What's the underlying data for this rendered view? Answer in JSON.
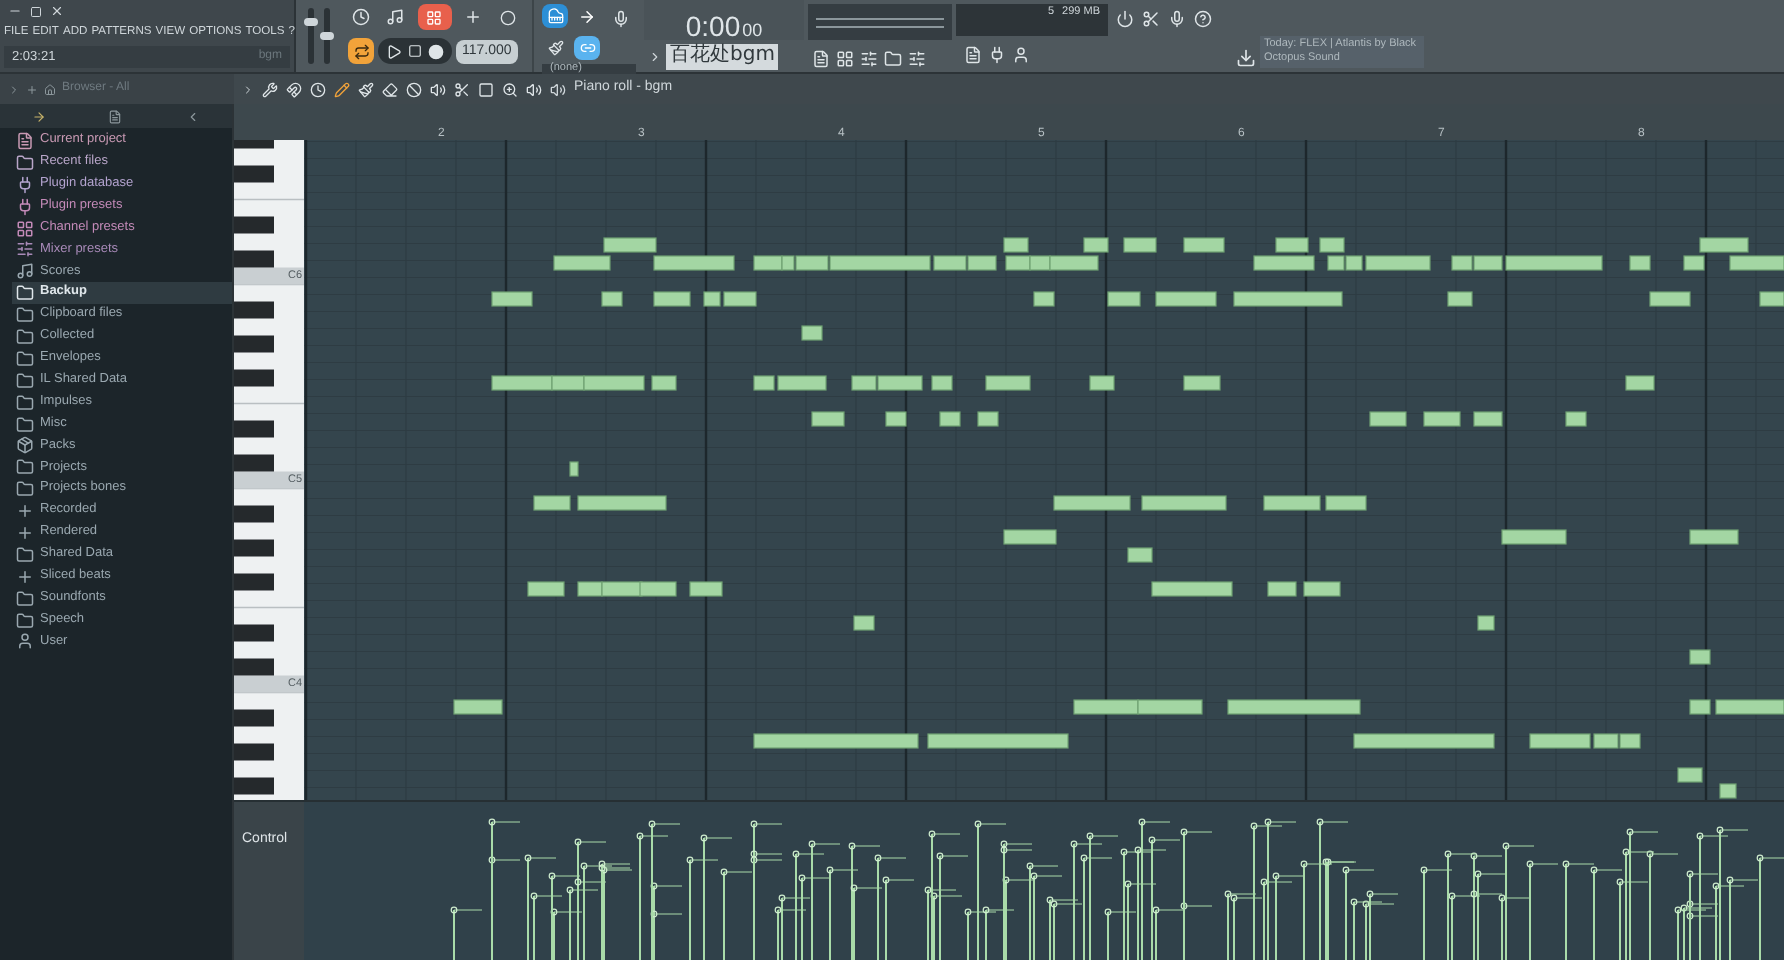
{
  "main_menu": {
    "items": [
      "FILE",
      "EDIT",
      "ADD",
      "PATTERNS",
      "VIEW",
      "OPTIONS",
      "TOOLS",
      "?"
    ],
    "song_time": "2:03:21",
    "hint": "bgm"
  },
  "master": {
    "volume": {
      "level": 0.8
    },
    "pitch": {
      "level": 0.5
    }
  },
  "transport": {
    "tempo": "117.000",
    "loop_mode_on": true
  },
  "snap": {
    "value": "(none)"
  },
  "time_display": {
    "main": "0:00",
    "sub": "00"
  },
  "pattern": {
    "name": "百花处bgm"
  },
  "cpu": {
    "polyphony": "5",
    "memory": "299 MB"
  },
  "news": {
    "label": "Today:",
    "text": "FLEX | Atlantis by Black Octopus Sound"
  },
  "browser": {
    "title": "Browser - All",
    "items": [
      {
        "label": "Current project",
        "kind": "project",
        "color": "#c99ab4",
        "selected": false
      },
      {
        "label": "Recent files",
        "kind": "recent",
        "color": "#b9a6c9",
        "selected": false
      },
      {
        "label": "Plugin database",
        "kind": "plugin",
        "color": "#b3a3cf",
        "selected": false
      },
      {
        "label": "Plugin presets",
        "kind": "plugin",
        "color": "#c38ab8",
        "selected": false
      },
      {
        "label": "Channel presets",
        "kind": "channel",
        "color": "#c38ab8",
        "selected": false
      },
      {
        "label": "Mixer presets",
        "kind": "mixer",
        "color": "#a88ab8",
        "selected": false
      },
      {
        "label": "Scores",
        "kind": "scores",
        "color": "#9aa8b0",
        "selected": false
      },
      {
        "label": "Backup",
        "kind": "folder",
        "color": "#dfe6ea",
        "selected": true
      },
      {
        "label": "Clipboard files",
        "kind": "folder",
        "color": "#9aa8b0",
        "selected": false
      },
      {
        "label": "Collected",
        "kind": "folder",
        "color": "#9aa8b0",
        "selected": false
      },
      {
        "label": "Envelopes",
        "kind": "folder",
        "color": "#9aa8b0",
        "selected": false
      },
      {
        "label": "IL Shared Data",
        "kind": "folder",
        "color": "#9aa8b0",
        "selected": false
      },
      {
        "label": "Impulses",
        "kind": "folder",
        "color": "#9aa8b0",
        "selected": false
      },
      {
        "label": "Misc",
        "kind": "folder",
        "color": "#9aa8b0",
        "selected": false
      },
      {
        "label": "Packs",
        "kind": "packs",
        "color": "#9aa8b0",
        "selected": false
      },
      {
        "label": "Projects",
        "kind": "folder",
        "color": "#9aa8b0",
        "selected": false
      },
      {
        "label": "Projects bones",
        "kind": "folder",
        "color": "#9aa8b0",
        "selected": false
      },
      {
        "label": "Recorded",
        "kind": "recorded",
        "color": "#9aa8b0",
        "selected": false
      },
      {
        "label": "Rendered",
        "kind": "recorded",
        "color": "#9aa8b0",
        "selected": false
      },
      {
        "label": "Shared Data",
        "kind": "folder",
        "color": "#9aa8b0",
        "selected": false
      },
      {
        "label": "Sliced beats",
        "kind": "recorded",
        "color": "#9aa8b0",
        "selected": false
      },
      {
        "label": "Soundfonts",
        "kind": "folder",
        "color": "#9aa8b0",
        "selected": false
      },
      {
        "label": "Speech",
        "kind": "folder",
        "color": "#9aa8b0",
        "selected": false
      },
      {
        "label": "User",
        "kind": "user",
        "color": "#9aa8b0",
        "selected": false
      }
    ]
  },
  "piano_roll": {
    "title": "Piano roll - bgm",
    "bars": [
      "2",
      "3",
      "4",
      "5",
      "6",
      "7",
      "8"
    ],
    "key_labels": [
      "C6",
      "C5",
      "C4"
    ],
    "control_lane": "Control"
  }
}
